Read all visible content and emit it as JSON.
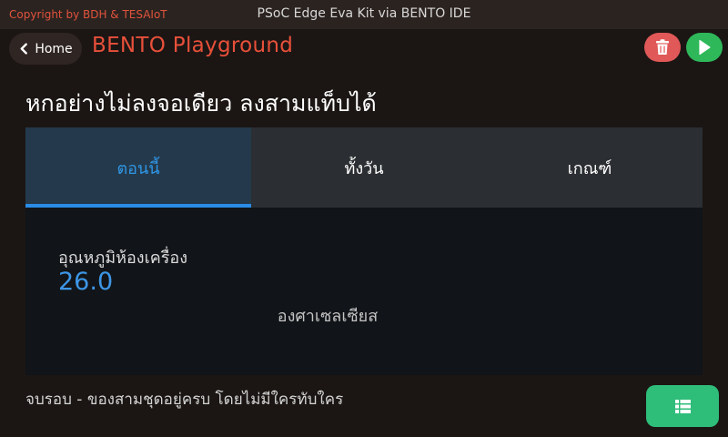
{
  "topbar": {
    "copyright": "Copyright by BDH & TESAIoT",
    "title": "PSoC Edge Eva Kit via BENTO IDE"
  },
  "header": {
    "home_label": "Home",
    "app_title": "BENTO Playground",
    "icons": {
      "back": "chevron-left-icon",
      "delete": "trash-icon",
      "run": "play-icon",
      "list": "list-icon"
    }
  },
  "main": {
    "heading": "หกอย่างไม่ลงจอเดียว ลงสามแท็บได้",
    "tabs": [
      {
        "label": "ตอนนี้",
        "active": true
      },
      {
        "label": "ทั้งวัน",
        "active": false
      },
      {
        "label": "เกณฑ์",
        "active": false
      }
    ],
    "sensor": {
      "label": "อุณหภูมิห้องเครื่อง",
      "value": "26.0",
      "unit": "องศาเซลเซียส"
    },
    "status": "จบรอบ - ของสามชุดอยู่ครบ โดยไม่มีใครทับใคร"
  },
  "colors": {
    "background": "#1b1614",
    "accent_red": "#e8503a",
    "tab_active_text": "#2f96e6",
    "delete_button": "#e05858",
    "run_button": "#2fb85a",
    "list_button": "#2fbd7a"
  }
}
